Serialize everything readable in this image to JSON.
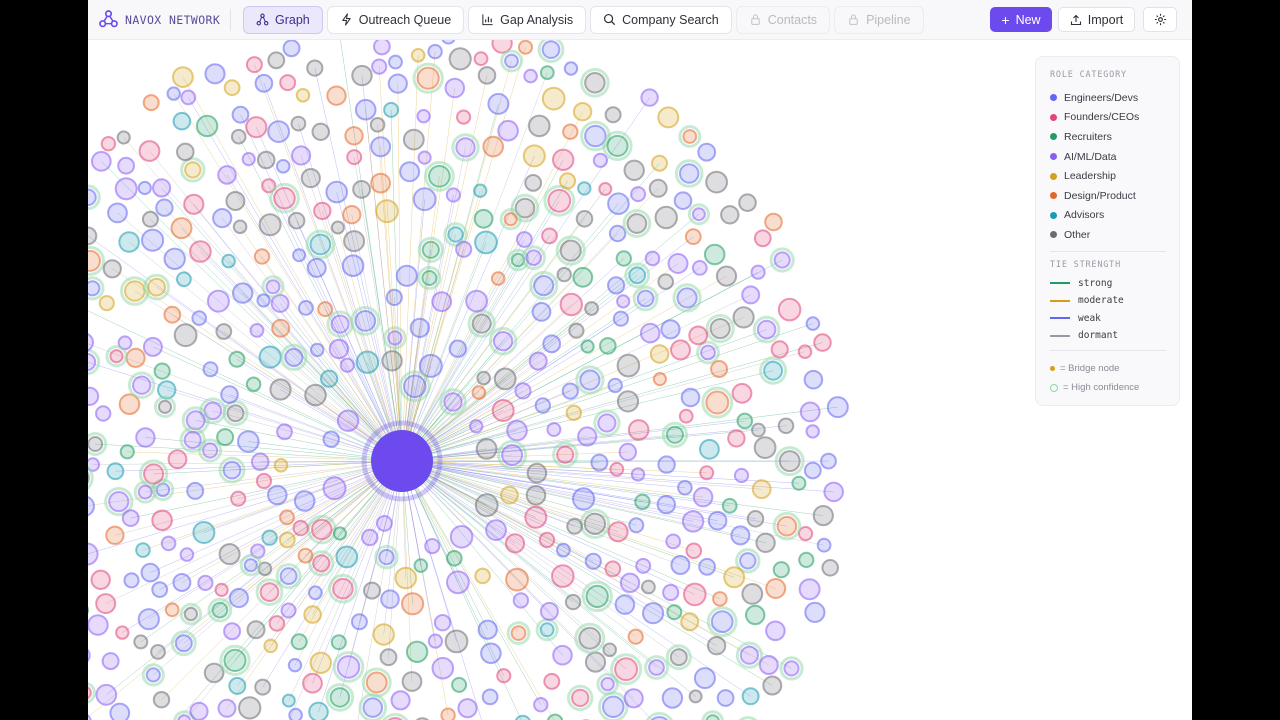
{
  "brand": {
    "name": "NAVOX NETWORK",
    "logo_icon": "network-nodes-icon"
  },
  "tabs": [
    {
      "label": "Graph",
      "icon": "graph-icon",
      "active": true,
      "locked": false
    },
    {
      "label": "Outreach Queue",
      "icon": "bolt-icon",
      "active": false,
      "locked": false
    },
    {
      "label": "Gap Analysis",
      "icon": "bar-chart-icon",
      "active": false,
      "locked": false
    },
    {
      "label": "Company Search",
      "icon": "search-icon",
      "active": false,
      "locked": false
    },
    {
      "label": "Contacts",
      "icon": "lock-icon",
      "active": false,
      "locked": true
    },
    {
      "label": "Pipeline",
      "icon": "lock-icon",
      "active": false,
      "locked": true
    }
  ],
  "actions": {
    "new_label": "New",
    "import_label": "Import",
    "settings_icon": "gear-icon"
  },
  "legend": {
    "role_title": "ROLE CATEGORY",
    "roles": [
      {
        "label": "Engineers/Devs",
        "color": "#6366f1"
      },
      {
        "label": "Founders/CEOs",
        "color": "#e0457b"
      },
      {
        "label": "Recruiters",
        "color": "#1f9d63"
      },
      {
        "label": "AI/ML/Data",
        "color": "#8b5cf6"
      },
      {
        "label": "Leadership",
        "color": "#d4a017"
      },
      {
        "label": "Design/Product",
        "color": "#e3672b"
      },
      {
        "label": "Advisors",
        "color": "#1a9bb0"
      },
      {
        "label": "Other",
        "color": "#6b6b75"
      }
    ],
    "tie_title": "TIE STRENGTH",
    "ties": [
      {
        "label": "strong",
        "color": "#1f9d63"
      },
      {
        "label": "moderate",
        "color": "#d4a017"
      },
      {
        "label": "weak",
        "color": "#6366f1"
      },
      {
        "label": "dormant",
        "color": "#9a9aa3"
      }
    ],
    "notes": [
      {
        "label": "= Bridge node",
        "color": "#d4a017",
        "kind": "dot"
      },
      {
        "label": "= High confidence",
        "color": "#8fd6a8",
        "kind": "ring"
      }
    ]
  },
  "graph": {
    "center_color": "#6d4aed",
    "node_count": 720
  }
}
